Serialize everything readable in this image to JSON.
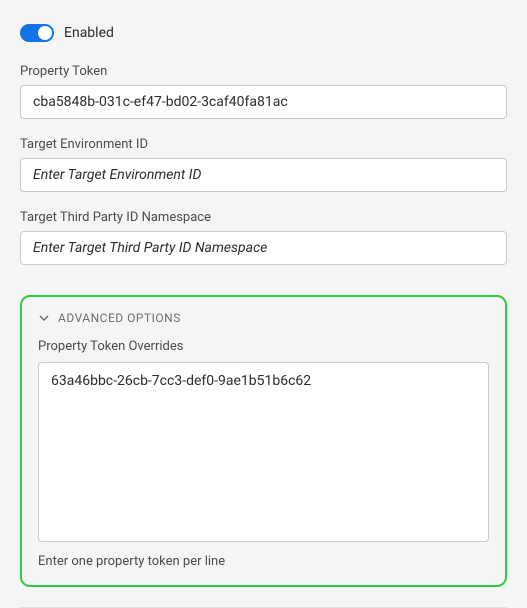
{
  "toggle": {
    "label": "Enabled",
    "checked": true
  },
  "fields": {
    "propertyToken": {
      "label": "Property Token",
      "value": "cba5848b-031c-ef47-bd02-3caf40fa81ac",
      "placeholder": ""
    },
    "targetEnvId": {
      "label": "Target Environment ID",
      "value": "",
      "placeholder": "Enter Target Environment ID"
    },
    "thirdPartyNs": {
      "label": "Target Third Party ID Namespace",
      "value": "",
      "placeholder": "Enter Target Third Party ID Namespace"
    }
  },
  "advanced": {
    "title": "ADVANCED OPTIONS",
    "overrides": {
      "label": "Property Token Overrides",
      "value": "63a46bbc-26cb-7cc3-def0-9ae1b51b6c62",
      "help": "Enter one property token per line"
    }
  }
}
